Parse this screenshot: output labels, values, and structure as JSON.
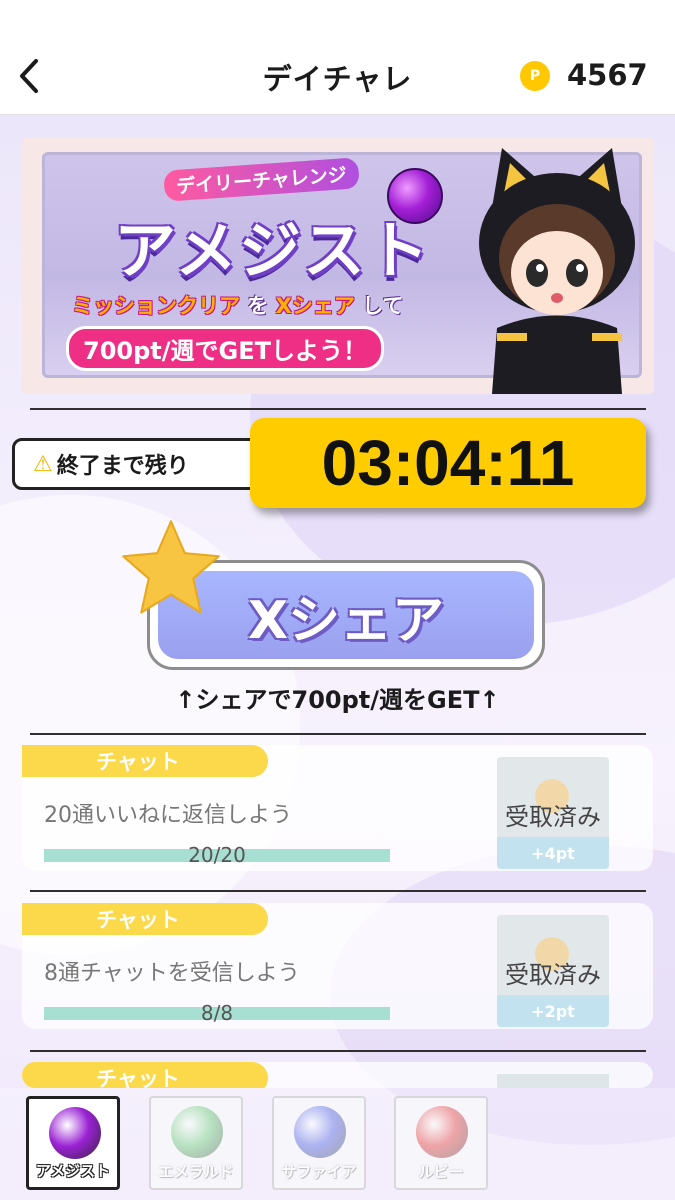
{
  "header": {
    "title": "デイチャレ",
    "coin_symbol": "P",
    "points": "4567"
  },
  "banner": {
    "subtitle": "デイリーチャレンジ",
    "gem_name": "アメジスト",
    "line_a": "ミッションクリア",
    "line_b": "を",
    "line_c": "Xシェア",
    "line_d": "して",
    "pill": "700pt/週でGETしよう！"
  },
  "timer": {
    "warning_icon": "⚠",
    "label": "終了まで残り",
    "value": "03:04:11"
  },
  "share": {
    "button_label": "Xシェア",
    "caption": "↑シェアで700pt/週をGET↑"
  },
  "missions": [
    {
      "category": "チャット",
      "text": "20通いいねに返信しよう",
      "progress": "20/20",
      "progress_fraction": 1.0,
      "reward_status": "受取済み",
      "reward_points": "+4pt"
    },
    {
      "category": "チャット",
      "text": "8通チャットを受信しよう",
      "progress": "8/8",
      "progress_fraction": 1.0,
      "reward_status": "受取済み",
      "reward_points": "+2pt"
    },
    {
      "category": "チャット"
    }
  ],
  "gem_tabs": [
    {
      "label": "アメジスト",
      "color": "#9b22d4",
      "active": true
    },
    {
      "label": "エメラルド",
      "color": "#58c46a",
      "active": false
    },
    {
      "label": "サファイア",
      "color": "#3b4ee0",
      "active": false
    },
    {
      "label": "ルビー",
      "color": "#e12a2a",
      "active": false
    }
  ],
  "colors": {
    "timer_bg": "#ffcc00",
    "tag_bg": "#fbd94a",
    "progress_bar": "#a7dfd2",
    "share_button": "#a8b6ff"
  }
}
